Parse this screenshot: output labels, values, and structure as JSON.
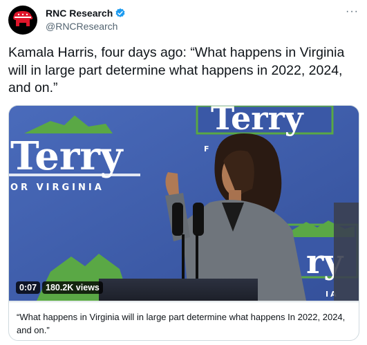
{
  "account": {
    "name": "RNC Research",
    "handle": "@RNCResearch",
    "avatar_icon": "republican-elephant-icon",
    "verified_icon": "verified-badge-icon",
    "verified_color": "#1d9bf0"
  },
  "more_icon": "more-options-icon",
  "more_glyph": "···",
  "tweet": {
    "text": "Kamala Harris, four days ago: “What happens in Virginia will in large part determine what happens in 2022, 2024, and on.”"
  },
  "media": {
    "signs": {
      "terry_left": "Terry",
      "for_virginia_left": "OR VIRGINIA",
      "terry_top": "Terry",
      "for_virginia_top": "F    GINIA",
      "terry_right": "ry",
      "for_virginia_right": "IA"
    },
    "timestamp": "0:07",
    "views": "180.2K views",
    "caption": "“What happens in Virginia will in large part determine what happens In 2022, 2024, and on.”",
    "colors": {
      "backdrop": "#3f5fae",
      "sign_green": "#5aa845",
      "sign_text": "#ffffff"
    }
  }
}
